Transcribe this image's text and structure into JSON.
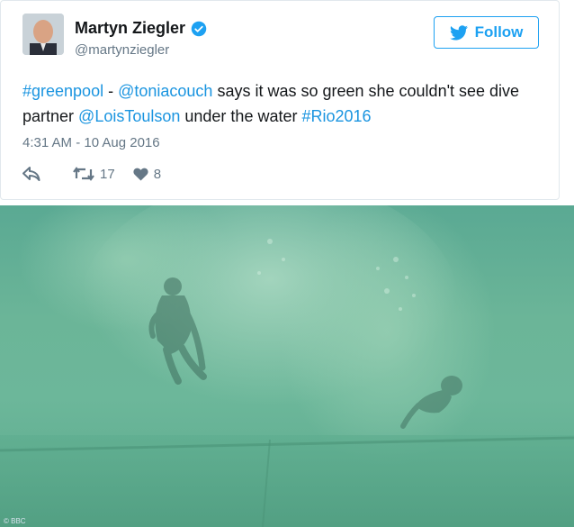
{
  "user": {
    "name": "Martyn Ziegler",
    "handle": "@martynziegler"
  },
  "follow_label": "Follow",
  "tweet": {
    "segments": [
      {
        "text": "#greenpool",
        "link": true
      },
      {
        "text": " - ",
        "link": false
      },
      {
        "text": "@toniacouch",
        "link": true
      },
      {
        "text": " says it was so green she couldn't see dive partner ",
        "link": false
      },
      {
        "text": "@LoisToulson",
        "link": true
      },
      {
        "text": " under the water ",
        "link": false
      },
      {
        "text": "#Rio2016",
        "link": true
      }
    ],
    "timestamp": "4:31 AM - 10 Aug 2016"
  },
  "stats": {
    "retweets": "17",
    "likes": "8"
  },
  "photo": {
    "credit": "© BBC"
  },
  "colors": {
    "accent": "#1da1f2",
    "link": "#1b95e0",
    "water": "#6bb598"
  }
}
